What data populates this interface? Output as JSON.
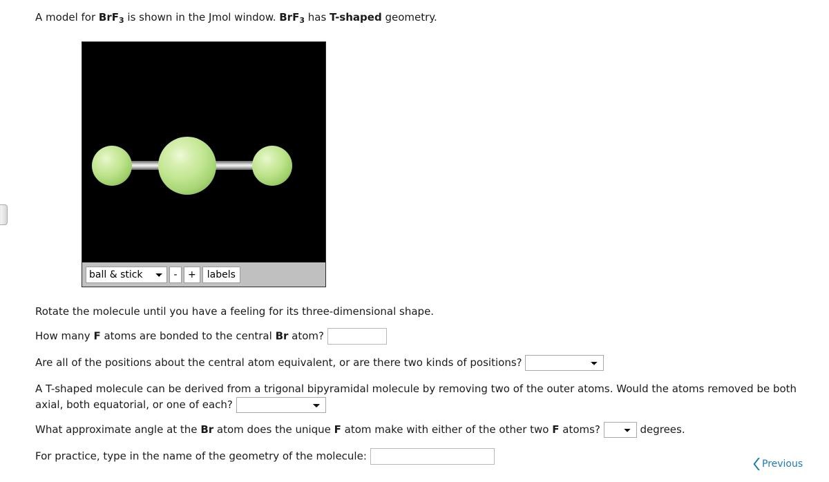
{
  "intro": {
    "part1": "A model for ",
    "formula1_main": "BrF",
    "formula1_sub": "3",
    "part2": " is shown in the Jmol window. ",
    "formula2_main": "BrF",
    "formula2_sub": "3",
    "part3": " has ",
    "geometry_bold": "T-shaped",
    "part4": " geometry."
  },
  "jmol": {
    "style_select_value": "ball & stick",
    "style_options": [
      "ball & stick"
    ],
    "zoom_out_label": "-",
    "zoom_in_label": "+",
    "labels_label": "labels",
    "atoms": [
      {
        "name": "fluorine-left",
        "element": "F",
        "color": "#bde38b"
      },
      {
        "name": "bromine-center",
        "element": "Br",
        "color": "#c2e692"
      },
      {
        "name": "fluorine-right",
        "element": "F",
        "color": "#bde38b"
      }
    ],
    "bond_color": "#d8d8d8",
    "background_color": "#000000"
  },
  "questions": {
    "rotate_instruction": "Rotate the molecule until you have a feeling for its three-dimensional shape.",
    "q1": {
      "text_before": "How many ",
      "bold1": "F",
      "text_mid": " atoms are bonded to the central ",
      "bold2": "Br",
      "text_after": " atom?",
      "answer_value": ""
    },
    "q2": {
      "text": "Are all of the positions about the central atom equivalent, or are there two kinds of positions?",
      "answer_value": ""
    },
    "q3": {
      "text": "A T-shaped molecule can be derived from a trigonal bipyramidal molecule by removing two of the outer atoms. Would the atoms removed be both axial, both equatorial, or one of each?",
      "answer_value": ""
    },
    "q4": {
      "text_before": "What approximate angle at the ",
      "bold1": "Br",
      "text_mid1": " atom does the unique ",
      "bold2": "F",
      "text_mid2": " atom make with either of the other two ",
      "bold3": "F",
      "text_after": " atoms?",
      "units": "degrees.",
      "answer_value": ""
    },
    "q5": {
      "text": "For practice, type in the name of the geometry of the molecule:",
      "answer_value": ""
    }
  },
  "navigation": {
    "previous_label": "Previous",
    "previous_color": "#2179b5"
  }
}
